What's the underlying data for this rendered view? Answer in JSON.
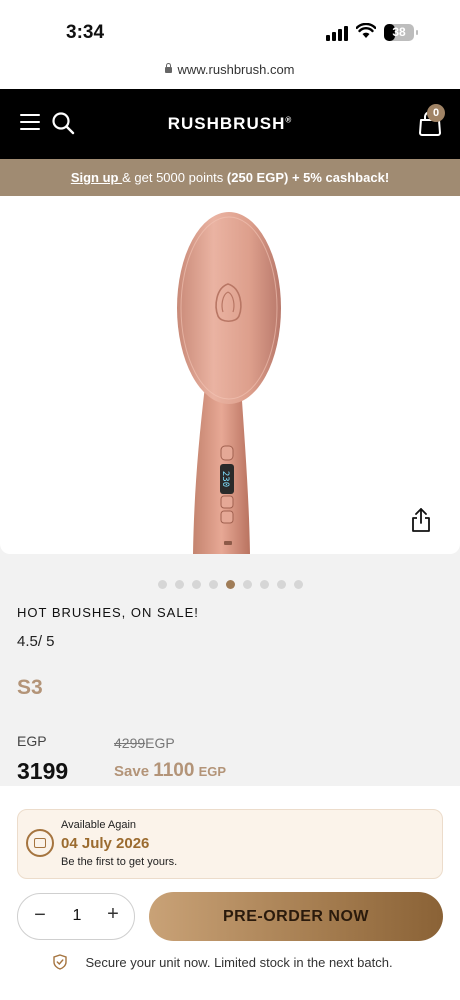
{
  "status_bar": {
    "time": "3:34",
    "battery": "38",
    "battery_level": 0.38
  },
  "browser": {
    "url": "www.rushbrush.com"
  },
  "header": {
    "logo": "RUSHBRUSH",
    "logo_mark": "®",
    "cart_count": "0"
  },
  "promo": {
    "link": "Sign up ",
    "text": "& get 5000 points ",
    "bold": "(250 EGP) + 5% cashback!"
  },
  "gallery": {
    "dot_count": 9,
    "active_index": 4,
    "display_readout": "230"
  },
  "product": {
    "category": "HOT BRUSHES,  ON SALE!",
    "rating": "4.5/ 5",
    "model": "S3",
    "currency": "EGP",
    "price": "3199",
    "old_price": "4299",
    "old_price_unit": "EGP",
    "save_label": "Save",
    "save_amount": "1100",
    "save_unit": "EGP"
  },
  "availability": {
    "label": "Available Again",
    "date": "04 July 2026",
    "note": "Be the first to get yours."
  },
  "quantity": {
    "minus": "−",
    "value": "1",
    "plus": "+"
  },
  "cta": {
    "label": "PRE-ORDER NOW"
  },
  "footer_note": "Secure your unit now. Limited stock in the next batch.",
  "colors": {
    "accent": "#b39478",
    "promo_bg": "#a08b72",
    "cta": "#a77f52",
    "header_bg": "#000000"
  }
}
